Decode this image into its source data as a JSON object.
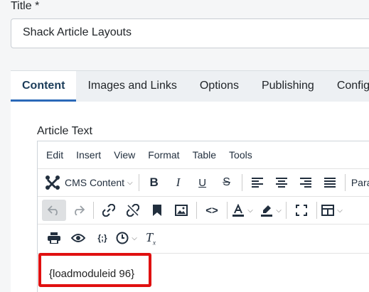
{
  "title_field": {
    "label": "Title *",
    "value": "Shack Article Layouts"
  },
  "tabs": [
    {
      "label": "Content",
      "active": true
    },
    {
      "label": "Images and Links"
    },
    {
      "label": "Options"
    },
    {
      "label": "Publishing"
    },
    {
      "label": "Configu"
    }
  ],
  "editor": {
    "label": "Article Text",
    "menus": [
      "Edit",
      "Insert",
      "View",
      "Format",
      "Table",
      "Tools"
    ],
    "cms_content_label": "CMS Content",
    "paragraph_label": "Para",
    "content_text": "{loadmoduleid 96}"
  },
  "colors": {
    "accent": "#2a69b8",
    "highlight": "#e01010"
  }
}
